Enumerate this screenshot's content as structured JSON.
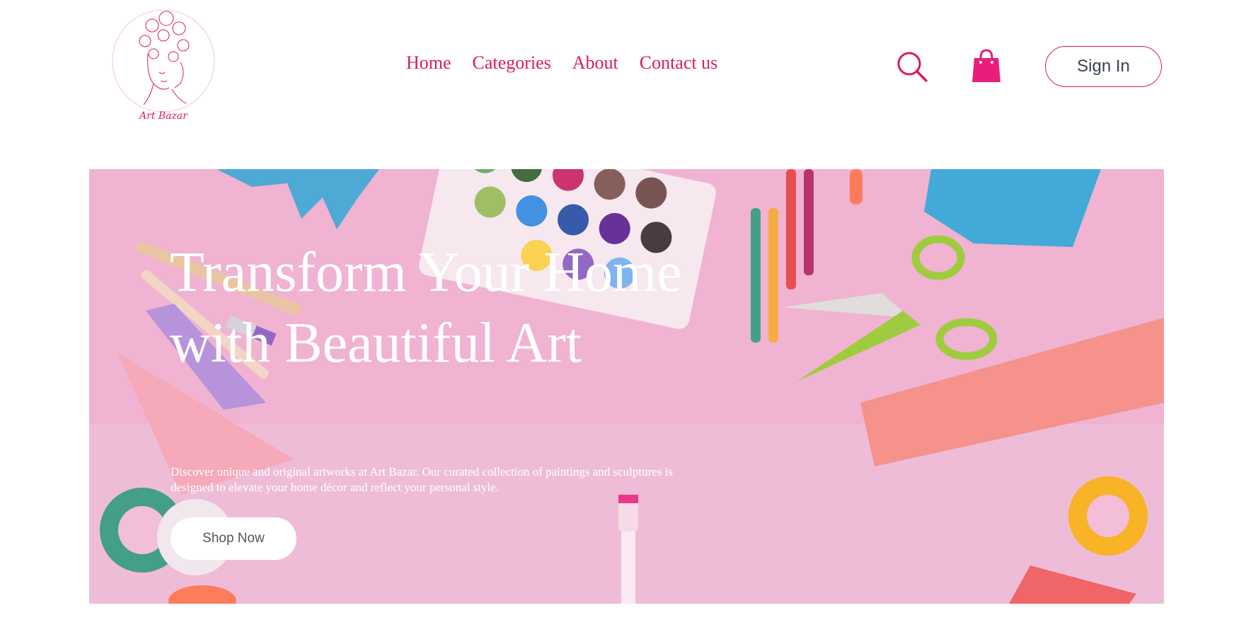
{
  "header": {
    "logo_alt": "Art Bazar",
    "nav": [
      {
        "label": "Home"
      },
      {
        "label": "Categories"
      },
      {
        "label": "About"
      },
      {
        "label": "Contact us"
      }
    ],
    "search_icon": "search-icon",
    "cart_icon": "shopping-bag-icon",
    "signin_label": "Sign In"
  },
  "hero": {
    "title": "Transform Your Home with Beautiful Art",
    "description": "Discover unique and original artworks at Art Bazar. Our curated collection of paintings and sculptures is designed to elevate your home décor and reflect your personal style.",
    "cta_label": "Shop Now"
  },
  "colors": {
    "accent": "#d81b60",
    "hero_background": "#f0b6d3",
    "text_on_hero": "#ffffff"
  }
}
